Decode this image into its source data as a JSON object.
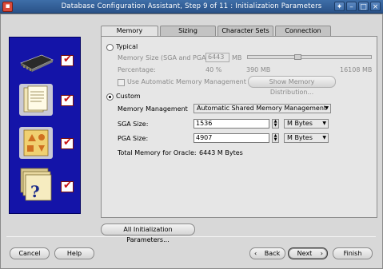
{
  "window": {
    "title": "Database Configuration Assistant, Step 9 of 11 : Initialization Parameters",
    "app_icon": "oracle-icon",
    "controls": [
      "restore-icon",
      "minimize-icon",
      "maximize-icon",
      "close-icon"
    ]
  },
  "side_panel": {
    "icons": [
      "memory-chip-icon",
      "documents-icon",
      "database-shapes-icon",
      "folders-help-icon"
    ],
    "check_color": "#c81414",
    "background": "#1414a8"
  },
  "tabs": [
    {
      "label": "Memory",
      "active": true
    },
    {
      "label": "Sizing",
      "active": false
    },
    {
      "label": "Character Sets",
      "active": false
    },
    {
      "label": "Connection Mode",
      "active": false
    }
  ],
  "memory": {
    "typical": {
      "label": "Typical",
      "memory_size_label": "Memory Size (SGA and PGA):",
      "memory_size_value": "6443",
      "memory_size_unit": "MB",
      "percentage_label": "Percentage:",
      "percentage_value": "40 %",
      "min_value": "390 MB",
      "max_value": "16108 MB",
      "auto_memory_label": "Use Automatic Memory Management",
      "show_distribution_label": "Show Memory Distribution...",
      "slider_level_percent": 40
    },
    "custom": {
      "label": "Custom",
      "management_label": "Memory Management",
      "management_value": "Automatic Shared Memory Management",
      "sga_label": "SGA Size:",
      "sga_value": "1536",
      "sga_unit": "M Bytes",
      "pga_label": "PGA Size:",
      "pga_value": "4907",
      "pga_unit": "M Bytes",
      "total_label": "Total Memory for Oracle:",
      "total_value": "6443 M Bytes"
    },
    "selected_mode": "Custom"
  },
  "all_params_label": "All Initialization Parameters...",
  "footer": {
    "cancel": "Cancel",
    "help": "Help",
    "back": "Back",
    "next": "Next",
    "finish": "Finish"
  }
}
